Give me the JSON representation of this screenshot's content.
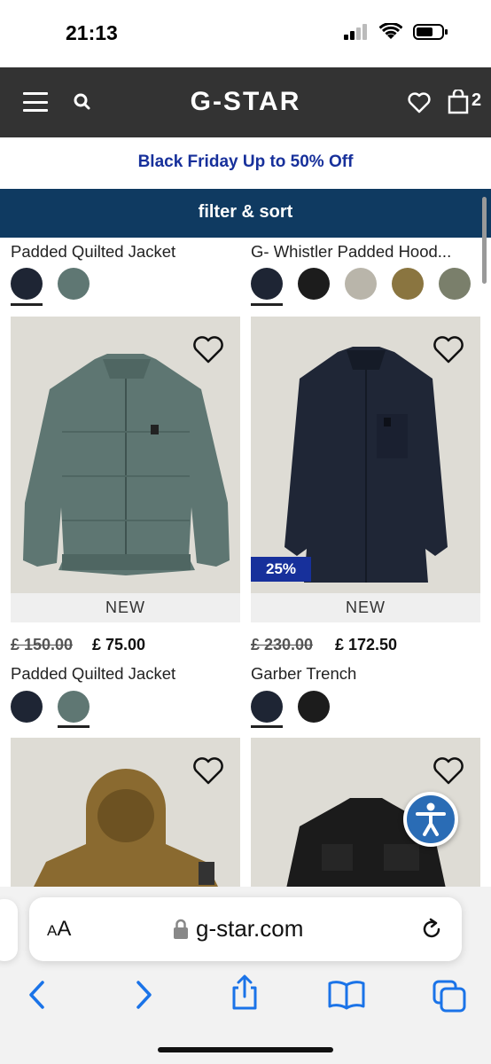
{
  "status": {
    "time": "21:13"
  },
  "header": {
    "logo": "G-STAR",
    "bag_count": "2"
  },
  "promo": {
    "text": "Black Friday Up to 50% Off"
  },
  "filter": {
    "label": "filter & sort"
  },
  "top_row": [
    {
      "title": "Padded Quilted Jacket"
    },
    {
      "title": "G- Whistler Padded Hood..."
    }
  ],
  "products": [
    {
      "tag": "NEW",
      "price_old": "£ 150.00",
      "price_new": "£ 75.00",
      "title": "Padded Quilted Jacket"
    },
    {
      "tag": "NEW",
      "badge": "25%",
      "price_old": "£ 230.00",
      "price_new": "£ 172.50",
      "title": "Garber Trench"
    }
  ],
  "colors": {
    "header_bg": "#333333",
    "promo_text": "#17309b",
    "filter_bg": "#0f3a61",
    "swatch_navy": "#1e2534",
    "swatch_slate": "#5f7773",
    "swatch_black": "#1c1c1c",
    "swatch_stone": "#b9b5aa",
    "swatch_olive": "#8a7540",
    "swatch_khaki": "#7a7f6b"
  },
  "browser": {
    "aa": "AA",
    "url": "g-star.com"
  }
}
